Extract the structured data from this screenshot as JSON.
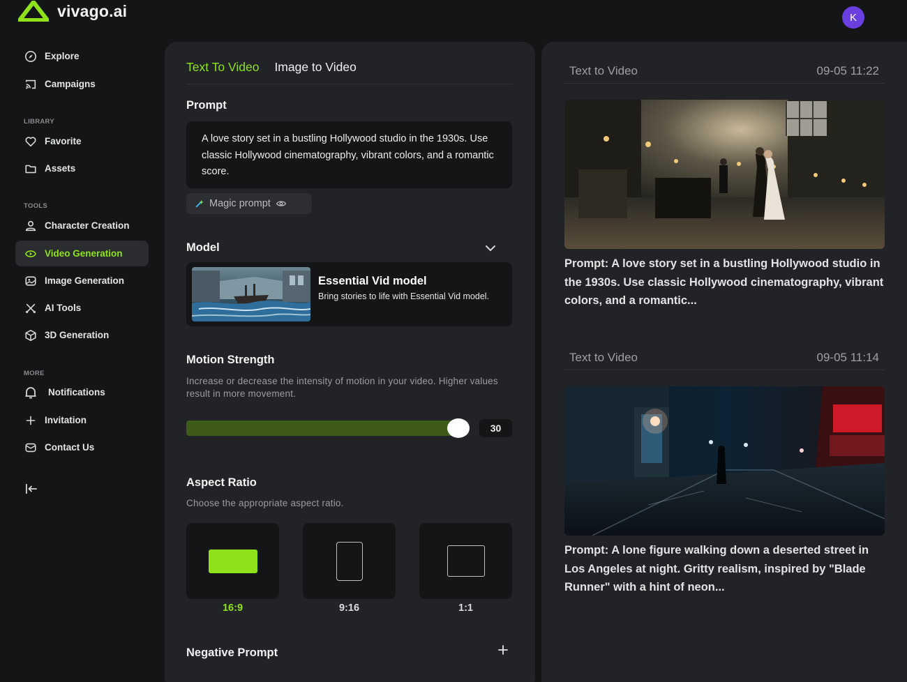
{
  "app": {
    "name": "vivago.ai",
    "avatar_initial": "K",
    "accent_color": "#8fe21a"
  },
  "sidebar": {
    "items_top": [
      {
        "label": "Explore",
        "icon": "compass-icon"
      },
      {
        "label": "Campaigns",
        "icon": "cast-icon"
      }
    ],
    "library_label": "LIBRARY",
    "library_items": [
      {
        "label": "Favorite",
        "icon": "heart-icon"
      },
      {
        "label": "Assets",
        "icon": "folder-icon"
      }
    ],
    "tools_label": "TOOLS",
    "tools_items": [
      {
        "label": "Character Creation",
        "icon": "user-icon"
      },
      {
        "label": "Video Generation",
        "icon": "video-icon",
        "active": true
      },
      {
        "label": "Image Generation",
        "icon": "image-icon"
      },
      {
        "label": "AI Tools",
        "icon": "tools-icon"
      },
      {
        "label": "3D Generation",
        "icon": "cube-icon"
      }
    ],
    "more_label": "MORE",
    "more_items": [
      {
        "label": "Notifications",
        "icon": "bell-icon"
      },
      {
        "label": "Invitation",
        "icon": "plus-icon"
      },
      {
        "label": "Contact Us",
        "icon": "mail-icon"
      }
    ]
  },
  "generator": {
    "tabs": [
      {
        "label": "Text To Video",
        "active": true
      },
      {
        "label": "Image to Video",
        "active": false
      }
    ],
    "prompt": {
      "label": "Prompt",
      "value": "A love story set in a bustling Hollywood studio in the 1930s. Use classic Hollywood cinematography, vibrant colors, and a romantic score.",
      "magic_label": "Magic prompt"
    },
    "model": {
      "label": "Model",
      "name": "Essential Vid model",
      "description": "Bring stories to life with Essential Vid model."
    },
    "motion": {
      "label": "Motion Strength",
      "description": "Increase or decrease the intensity of motion in your video. Higher values result in more movement.",
      "value": "30",
      "fill_fraction": 0.96
    },
    "aspect": {
      "label": "Aspect Ratio",
      "description": "Choose the appropriate aspect ratio.",
      "options": [
        {
          "label": "16:9",
          "active": true
        },
        {
          "label": "9:16",
          "active": false
        },
        {
          "label": "1:1",
          "active": false
        }
      ]
    },
    "negative": {
      "label": "Negative Prompt"
    }
  },
  "results": [
    {
      "type": "Text to Video",
      "time": "09-05 11:22",
      "prompt": "Prompt: A love story set in a bustling Hollywood studio in the 1930s. Use classic Hollywood cinematography, vibrant colors, and a romantic..."
    },
    {
      "type": "Text to Video",
      "time": "09-05 11:14",
      "prompt": "Prompt: A lone figure walking down a deserted street in Los Angeles at night. Gritty realism, inspired by \"Blade Runner\" with a hint of neon..."
    }
  ]
}
